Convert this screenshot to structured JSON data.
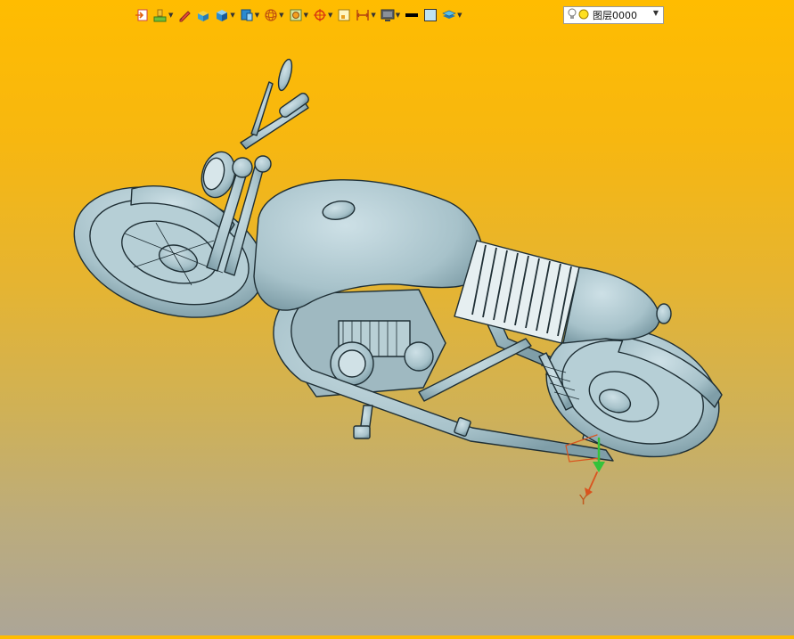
{
  "toolbar": {
    "buttons": [
      {
        "name": "exit-sketch-icon",
        "dropdown": false
      },
      {
        "name": "paint-brush-icon",
        "dropdown": true
      },
      {
        "name": "pencil-icon",
        "dropdown": false
      },
      {
        "name": "shaded-block-icon",
        "dropdown": false
      },
      {
        "name": "solid-cube-icon",
        "dropdown": true
      },
      {
        "name": "view-orientation-icon",
        "dropdown": true
      },
      {
        "name": "wireframe-sphere-icon",
        "dropdown": true
      },
      {
        "name": "render-style-icon",
        "dropdown": true
      },
      {
        "name": "snap-point-icon",
        "dropdown": true
      },
      {
        "name": "selection-filter-icon",
        "dropdown": false
      },
      {
        "name": "measure-icon",
        "dropdown": true
      },
      {
        "name": "display-monitor-icon",
        "dropdown": true
      },
      {
        "name": "line-color-icon",
        "dropdown": false
      },
      {
        "name": "fill-color-icon",
        "dropdown": false
      },
      {
        "name": "layer-stack-icon",
        "dropdown": true
      }
    ],
    "layer_selector": {
      "value": "图层0000",
      "icons": [
        "lightbulb-icon",
        "yellow-circle-icon"
      ]
    }
  },
  "viewport": {
    "triad_label": "Y",
    "colors": {
      "background_top": "#ffbc00",
      "background_bottom": "#aca597",
      "model": "#a9c4cc",
      "edges": "#1f2f35",
      "triad_y": "#d9531e",
      "triad_z": "#34c23a"
    }
  }
}
